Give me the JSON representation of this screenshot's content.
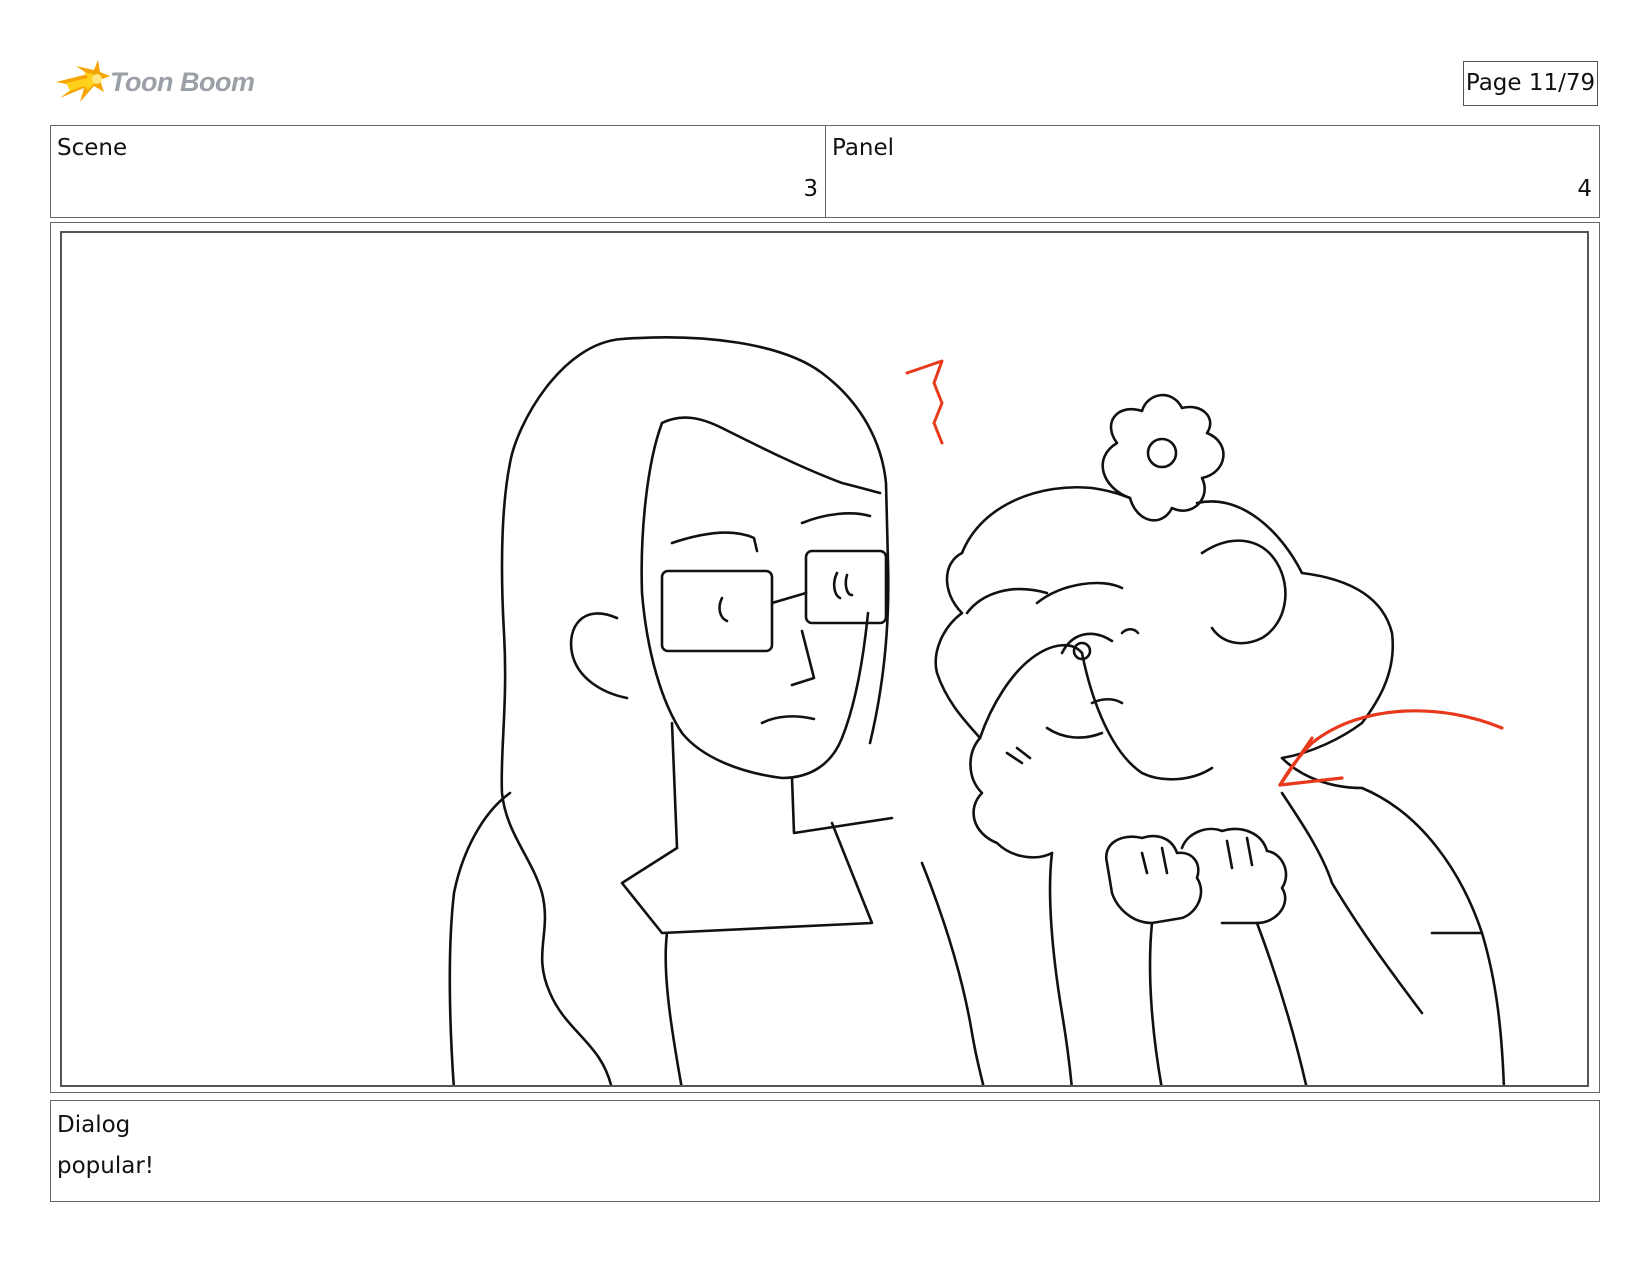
{
  "header": {
    "logo_text": "Toon Boom",
    "page_label": "Page 11/79"
  },
  "info": {
    "scene_label": "Scene",
    "scene_value": "3",
    "panel_label": "Panel",
    "panel_value": "4"
  },
  "dialog": {
    "label": "Dialog",
    "text": "popular!"
  },
  "colors": {
    "logo_orange": "#f5a400",
    "logo_yellow": "#ffd11a",
    "annotation_red": "#e8391d",
    "line_black": "#111111"
  }
}
